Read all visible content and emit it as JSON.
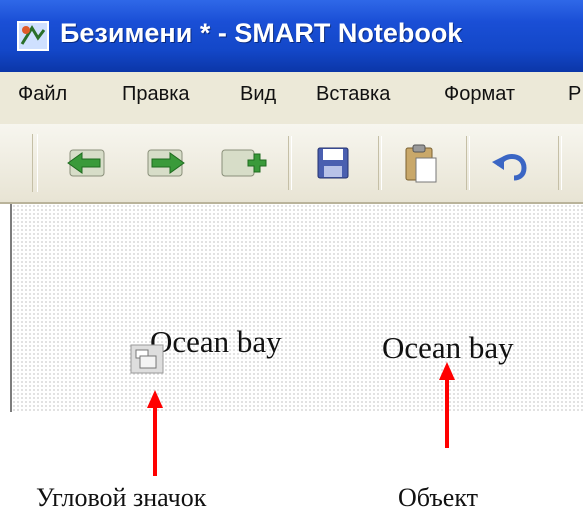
{
  "window": {
    "title": "Безимени * - SMART Notebook",
    "title_bar_color": "#1a4fd6"
  },
  "menu": {
    "items": [
      {
        "label": "Файл"
      },
      {
        "label": "Правка"
      },
      {
        "label": "Вид"
      },
      {
        "label": "Вставка"
      },
      {
        "label": "Формат"
      },
      {
        "label": "Р"
      }
    ]
  },
  "toolbar": {
    "buttons": [
      {
        "icon": "arrow-left-icon"
      },
      {
        "icon": "arrow-right-icon"
      },
      {
        "icon": "add-page-icon"
      },
      {
        "icon": "save-icon"
      },
      {
        "icon": "paste-icon"
      },
      {
        "icon": "undo-icon"
      }
    ]
  },
  "canvas": {
    "object_with_handle": {
      "text": "Ocean bay"
    },
    "object": {
      "text": "Ocean bay"
    }
  },
  "annotations": {
    "arrow_color": "#ff0000",
    "corner_icon_caption": "Угловой значок",
    "object_caption": "Объект"
  }
}
